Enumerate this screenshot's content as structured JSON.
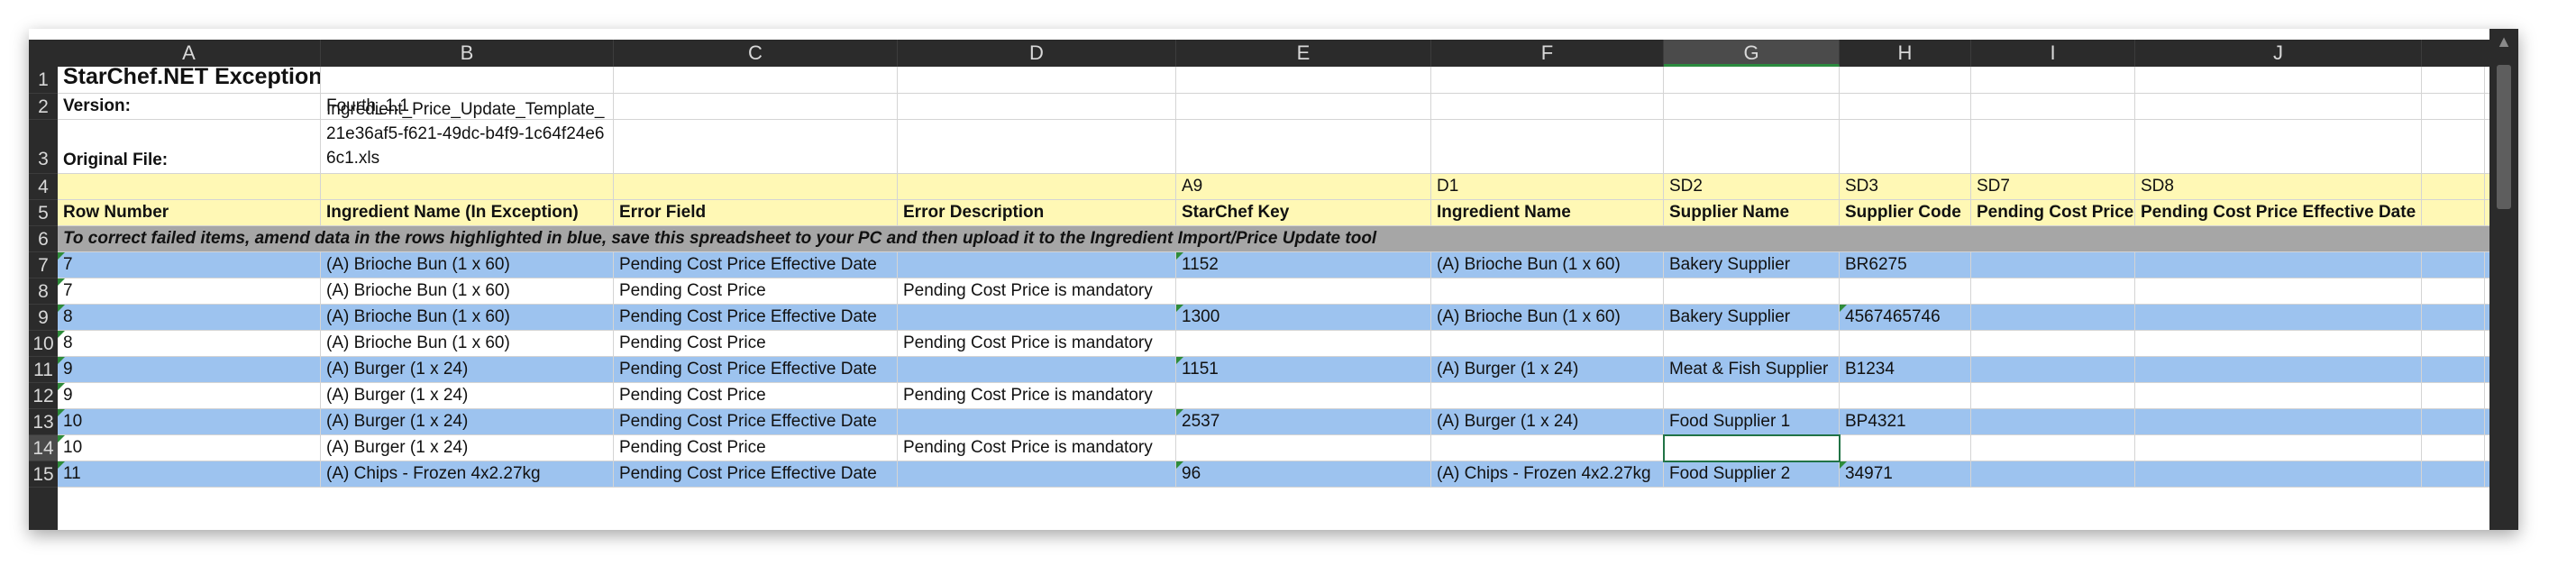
{
  "columns": [
    "A",
    "B",
    "C",
    "D",
    "E",
    "F",
    "G",
    "H",
    "I",
    "J"
  ],
  "selected_column": "G",
  "rows": [
    {
      "num": "1"
    },
    {
      "num": "2"
    },
    {
      "num": "3"
    },
    {
      "num": "4"
    },
    {
      "num": "5"
    },
    {
      "num": "6"
    },
    {
      "num": "7"
    },
    {
      "num": "8"
    },
    {
      "num": "9"
    },
    {
      "num": "10"
    },
    {
      "num": "11"
    },
    {
      "num": "12"
    },
    {
      "num": "13"
    },
    {
      "num": "14"
    },
    {
      "num": "15"
    }
  ],
  "sheet": {
    "title": "StarChef.NET Exception I",
    "version_label": "Version:",
    "version_value": "Fourth_1.1",
    "original_label": "Original File:",
    "original_value": "Ingredient_Price_Update_Template_21e36af5-f621-49dc-b4f9-1c64f24e66c1.xls",
    "codes": {
      "E": "A9",
      "F": "D1",
      "G": "SD2",
      "H": "SD3",
      "I": "SD7",
      "J": "SD8"
    },
    "headers": {
      "A": "Row Number",
      "B": "Ingredient Name (In Exception)",
      "C": "Error Field",
      "D": "Error Description",
      "E": "StarChef Key",
      "F": "Ingredient Name",
      "G": "Supplier Name",
      "H": "Supplier Code",
      "I": "Pending Cost Price",
      "J": "Pending Cost Price Effective Date"
    },
    "instruction": "To correct failed items, amend data in the rows highlighted in blue, save this spreadsheet to your PC and then upload it to the Ingredient Import/Price Update tool",
    "data_rows": [
      {
        "row_number": "7",
        "name": "(A) Brioche Bun (1 x 60)",
        "field": "Pending Cost Price Effective Date",
        "desc": "",
        "key": "1152",
        "ing": "(A) Brioche Bun (1 x 60)",
        "supplier": "Bakery Supplier",
        "code": "BR6275",
        "blue": true
      },
      {
        "row_number": "7",
        "name": "(A) Brioche Bun (1 x 60)",
        "field": "Pending Cost Price",
        "desc": "Pending Cost Price is mandatory",
        "key": "",
        "ing": "",
        "supplier": "",
        "code": "",
        "blue": false
      },
      {
        "row_number": "8",
        "name": "(A) Brioche Bun (1 x 60)",
        "field": "Pending Cost Price Effective Date",
        "desc": "",
        "key": "1300",
        "ing": "(A) Brioche Bun (1 x 60)",
        "supplier": "Bakery Supplier",
        "code": "4567465746",
        "blue": true
      },
      {
        "row_number": "8",
        "name": "(A) Brioche Bun (1 x 60)",
        "field": "Pending Cost Price",
        "desc": "Pending Cost Price is mandatory",
        "key": "",
        "ing": "",
        "supplier": "",
        "code": "",
        "blue": false
      },
      {
        "row_number": "9",
        "name": "(A) Burger (1 x 24)",
        "field": "Pending Cost Price Effective Date",
        "desc": "",
        "key": "1151",
        "ing": "(A) Burger (1 x 24)",
        "supplier": "Meat & Fish Supplier",
        "code": "B1234",
        "blue": true
      },
      {
        "row_number": "9",
        "name": "(A) Burger (1 x 24)",
        "field": "Pending Cost Price",
        "desc": "Pending Cost Price is mandatory",
        "key": "",
        "ing": "",
        "supplier": "",
        "code": "",
        "blue": false
      },
      {
        "row_number": "10",
        "name": "(A) Burger (1 x 24)",
        "field": "Pending Cost Price Effective Date",
        "desc": "",
        "key": "2537",
        "ing": "(A) Burger (1 x 24)",
        "supplier": "Food Supplier 1",
        "code": "BP4321",
        "blue": true
      },
      {
        "row_number": "10",
        "name": "(A) Burger (1 x 24)",
        "field": "Pending Cost Price",
        "desc": "Pending Cost Price is mandatory",
        "key": "",
        "ing": "",
        "supplier": "",
        "code": "",
        "blue": false
      },
      {
        "row_number": "11",
        "name": "(A) Chips - Frozen  4x2.27kg",
        "field": "Pending Cost Price Effective Date",
        "desc": "",
        "key": "96",
        "ing": "(A) Chips - Frozen  4x2.27kg",
        "supplier": "Food Supplier 2",
        "code": "34971",
        "blue": true
      }
    ]
  },
  "colors": {
    "blue_row": "#9dc3ef",
    "header_yellow": "#fff8b5",
    "instruction_gray": "#a6a6a6",
    "selection_green": "#217346"
  }
}
